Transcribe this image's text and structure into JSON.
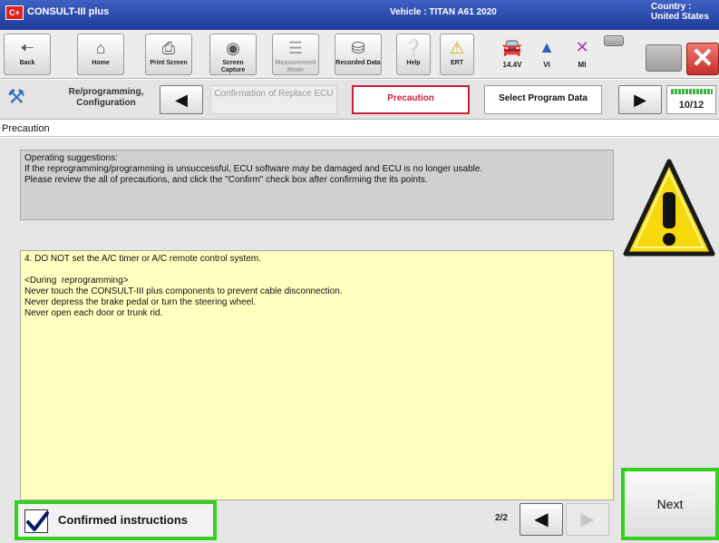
{
  "window": {
    "app_logo": "C+",
    "app_title": "CONSULT-III plus",
    "vehicle": "Vehicle : TITAN A61 2020",
    "country": "Country : United States"
  },
  "toolbar": {
    "buttons": [
      {
        "label": "Back",
        "icon": "arrow-left-icon"
      },
      {
        "label": "Home",
        "icon": "home-icon"
      },
      {
        "label": "Print Screen",
        "icon": "printer-icon"
      },
      {
        "label": "Screen Capture",
        "icon": "camera-icon"
      },
      {
        "label": "Measurement Mode",
        "icon": "measurement-icon"
      },
      {
        "label": "Recorded Data",
        "icon": "recorded-data-icon"
      },
      {
        "label": "Help",
        "icon": "help-icon"
      },
      {
        "label": "ERT",
        "icon": "warning-icon"
      }
    ],
    "status": [
      {
        "label": "14.4V",
        "icon": "car-battery-icon"
      },
      {
        "label": "VI",
        "icon": "signal-icon"
      },
      {
        "label": "MI",
        "icon": "x-icon"
      }
    ]
  },
  "steps": {
    "root": "Re/programming, Configuration",
    "past": "Confirmation of Replace ECU",
    "current": "Precaution",
    "next": "Select Program Data",
    "progress": "10/12"
  },
  "content": {
    "section_title": "Precaution",
    "notice_lines": [
      "Operating  suggestions:",
      "If the reprogramming/programming is unsuccessful, ECU software may be damaged and ECU is no longer usable.",
      "Please review the all of precautions, and click the \"Confirm\" check box after confirming the its points."
    ],
    "instructions": {
      "item": "4. DO NOT set the A/C timer or A/C remote control system.",
      "heading": "<During  reprogramming>",
      "lines": [
        "Never touch the CONSULT-III plus components to prevent cable disconnection.",
        "Never depress the brake pedal or turn the steering wheel.",
        "Never open each door or trunk rid."
      ]
    }
  },
  "footer": {
    "confirm_label": "Confirmed instructions",
    "confirm_checked": true,
    "page": "2/2",
    "next_label": "Next"
  },
  "colors": {
    "title_bar": "#2a4bb0",
    "highlight": "#35d11f",
    "current_step": "#c8203a",
    "instructions_bg": "#ffffc0",
    "warning_yellow": "#f5d90a"
  }
}
